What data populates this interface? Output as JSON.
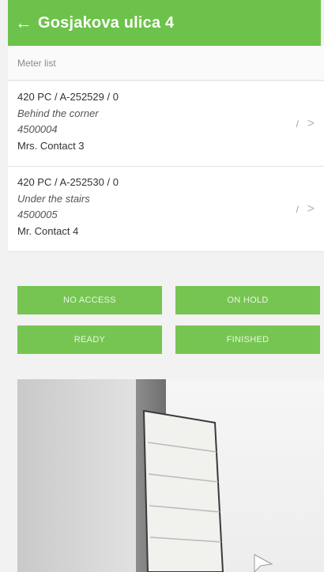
{
  "appbar": {
    "title": "Gosjakova ulica 4",
    "back_icon": "arrow-back"
  },
  "list_header": {
    "label": "Meter list"
  },
  "meters": [
    {
      "id_line": "420 PC / A-252529 / 0",
      "location": "Behind the corner",
      "code": "4500004",
      "contact": "Mrs. Contact 3",
      "edit_mark": "/",
      "chevron": ">"
    },
    {
      "id_line": "420 PC / A-252530 / 0",
      "location": "Under the stairs",
      "code": "4500005",
      "contact": "Mr. Contact 4",
      "edit_mark": "/",
      "chevron": ">"
    }
  ],
  "actions": {
    "no_access": "NO ACCESS",
    "on_hold": "ON HOLD",
    "ready": "READY",
    "finished": "FINISHED"
  },
  "colors": {
    "accent": "#6cc24a",
    "button": "#76c552"
  }
}
